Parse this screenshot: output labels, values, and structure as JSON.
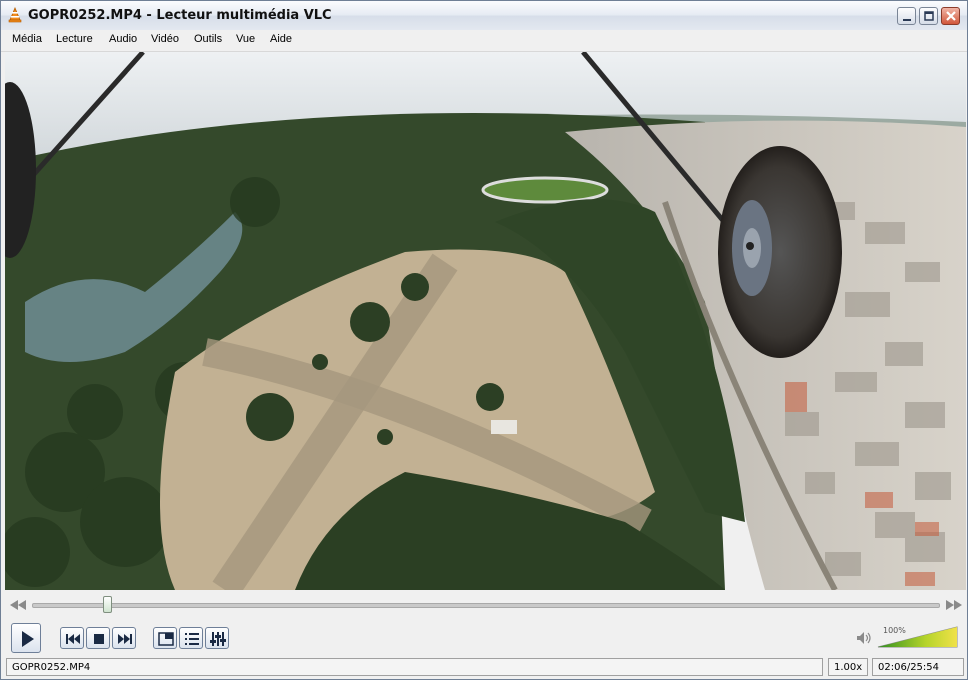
{
  "window": {
    "title": "GOPR0252.MP4 - Lecteur multimédia VLC",
    "app_icon": "vlc-cone-icon",
    "buttons": [
      "minimize-icon",
      "maximize-icon",
      "close-icon"
    ]
  },
  "menu": [
    "Média",
    "Lecture",
    "Audio",
    "Vidéo",
    "Outils",
    "Vue",
    "Aide"
  ],
  "video": {
    "description_icon": "video-frame",
    "sky_color": "#dfe4e8",
    "ground_color": "#b9a98c",
    "forest_color": "#2e4426"
  },
  "playback": {
    "position": 0.083,
    "volume_label": "100%",
    "volume": 1.0,
    "accent": "#3a9a2a"
  },
  "status": {
    "filename": "GOPR0252.MP4",
    "speed": "1.00x",
    "time": "02:06/25:54"
  }
}
